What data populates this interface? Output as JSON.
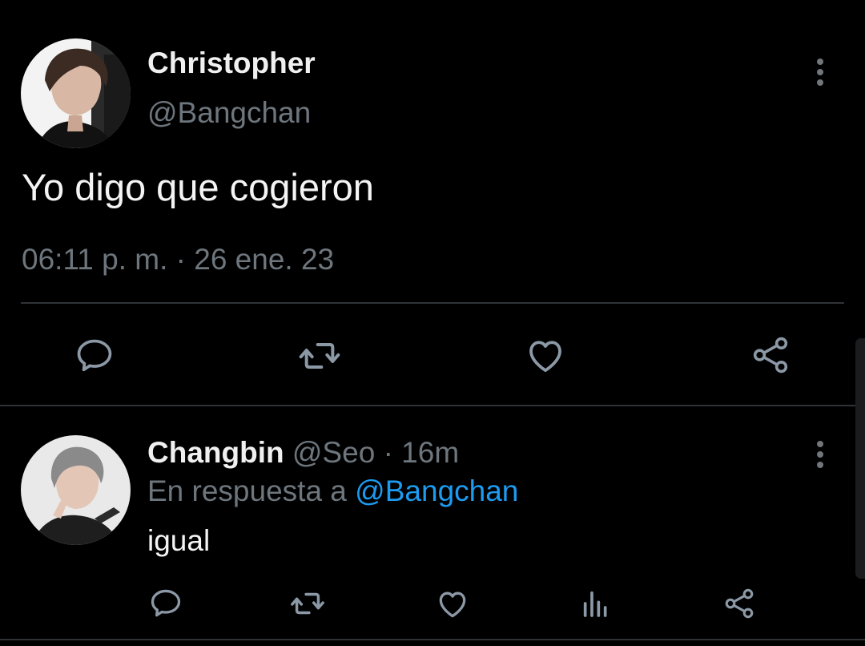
{
  "main_tweet": {
    "author_name": "Christopher",
    "author_handle": "@Bangchan",
    "text": "Yo digo que cogieron",
    "timestamp": "06:11 p. m. · 26 ene. 23",
    "avatar_icon": "profile-photo-icon",
    "actions": {
      "reply_icon": "comment-icon",
      "retweet_icon": "retweet-icon",
      "like_icon": "heart-icon",
      "share_icon": "share-icon"
    }
  },
  "reply_tweet": {
    "author_name": "Changbin",
    "author_handle": "@Seo",
    "separator": "·",
    "time_ago": "16m",
    "reply_context_prefix": "En respuesta a",
    "reply_context_handle": "@Bangchan",
    "text": "igual",
    "avatar_icon": "profile-photo-icon",
    "actions": {
      "reply_icon": "comment-icon",
      "retweet_icon": "retweet-icon",
      "like_icon": "heart-icon",
      "analytics_icon": "analytics-icon",
      "share_icon": "share-icon"
    }
  },
  "colors": {
    "background": "#000000",
    "primary_text": "#e7e9ea",
    "secondary_text": "#6e767d",
    "link": "#1d9bf0",
    "divider": "#2f3336",
    "icon": "#8b98a5"
  }
}
